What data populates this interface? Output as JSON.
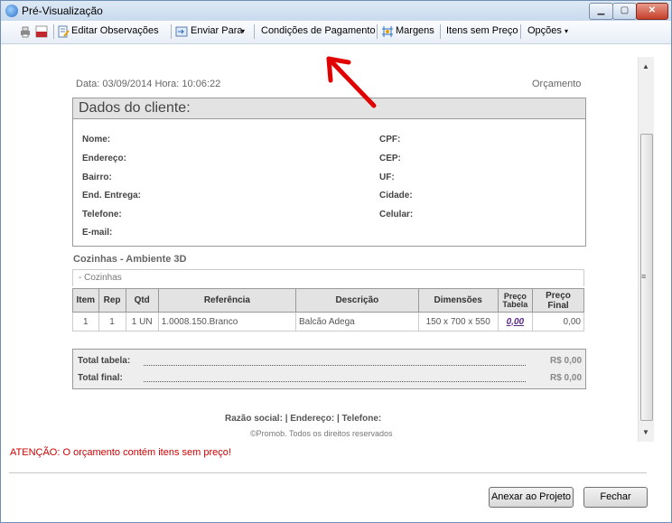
{
  "window": {
    "title": "Pré-Visualização"
  },
  "toolbar": {
    "edit_obs": "Editar Observações",
    "enviar": "Enviar Para",
    "condicoes": "Condições de Pagamento",
    "margens": "Margens",
    "itens_sem_preco": "Itens sem Preço",
    "opcoes": "Opções"
  },
  "report": {
    "date_line": "Data: 03/09/2014   Hora: 10:06:22",
    "doc_type": "Orçamento",
    "client_section_title": "Dados do cliente:",
    "client_labels_left": [
      "Nome:",
      "Endereço:",
      "Bairro:",
      "End. Entrega:",
      "Telefone:",
      "E-mail:"
    ],
    "client_labels_right": [
      "CPF:",
      "CEP:",
      "UF:",
      "Cidade:",
      "Celular:"
    ],
    "room_title": "Cozinhas - Ambiente 3D",
    "group_label": "- Cozinhas",
    "table_headers": [
      "Item",
      "Rep",
      "Qtd",
      "Referência",
      "Descrição",
      "Dimensões",
      "Preço Tabela",
      "Preço Final"
    ],
    "rows": [
      [
        "1",
        "1",
        "1 UN",
        "1.0008.150.Branco",
        "Balcão Adega",
        "150 x 700 x 550",
        "0,00",
        "0,00"
      ]
    ],
    "total_tabela_label": "Total tabela:",
    "total_tabela_value": "R$ 0,00",
    "total_final_label": "Total final:",
    "total_final_value": "R$ 0,00",
    "footer_line": "Razão social:    |    Endereço:    |    Telefone:",
    "copyright": "©Promob. Todos os direitos reservados"
  },
  "status": {
    "warning": "ATENÇÃO: O orçamento contém itens sem preço!"
  },
  "buttons": {
    "anexar": "Anexar ao Projeto",
    "fechar": "Fechar"
  },
  "colors": {
    "warning": "#d00000",
    "arrow": "#e00000",
    "price_link": "#5b2a8a"
  },
  "icons": [
    "app-icon",
    "printer-icon",
    "pdf-icon",
    "edit-icon",
    "send-icon",
    "margins-icon"
  ]
}
